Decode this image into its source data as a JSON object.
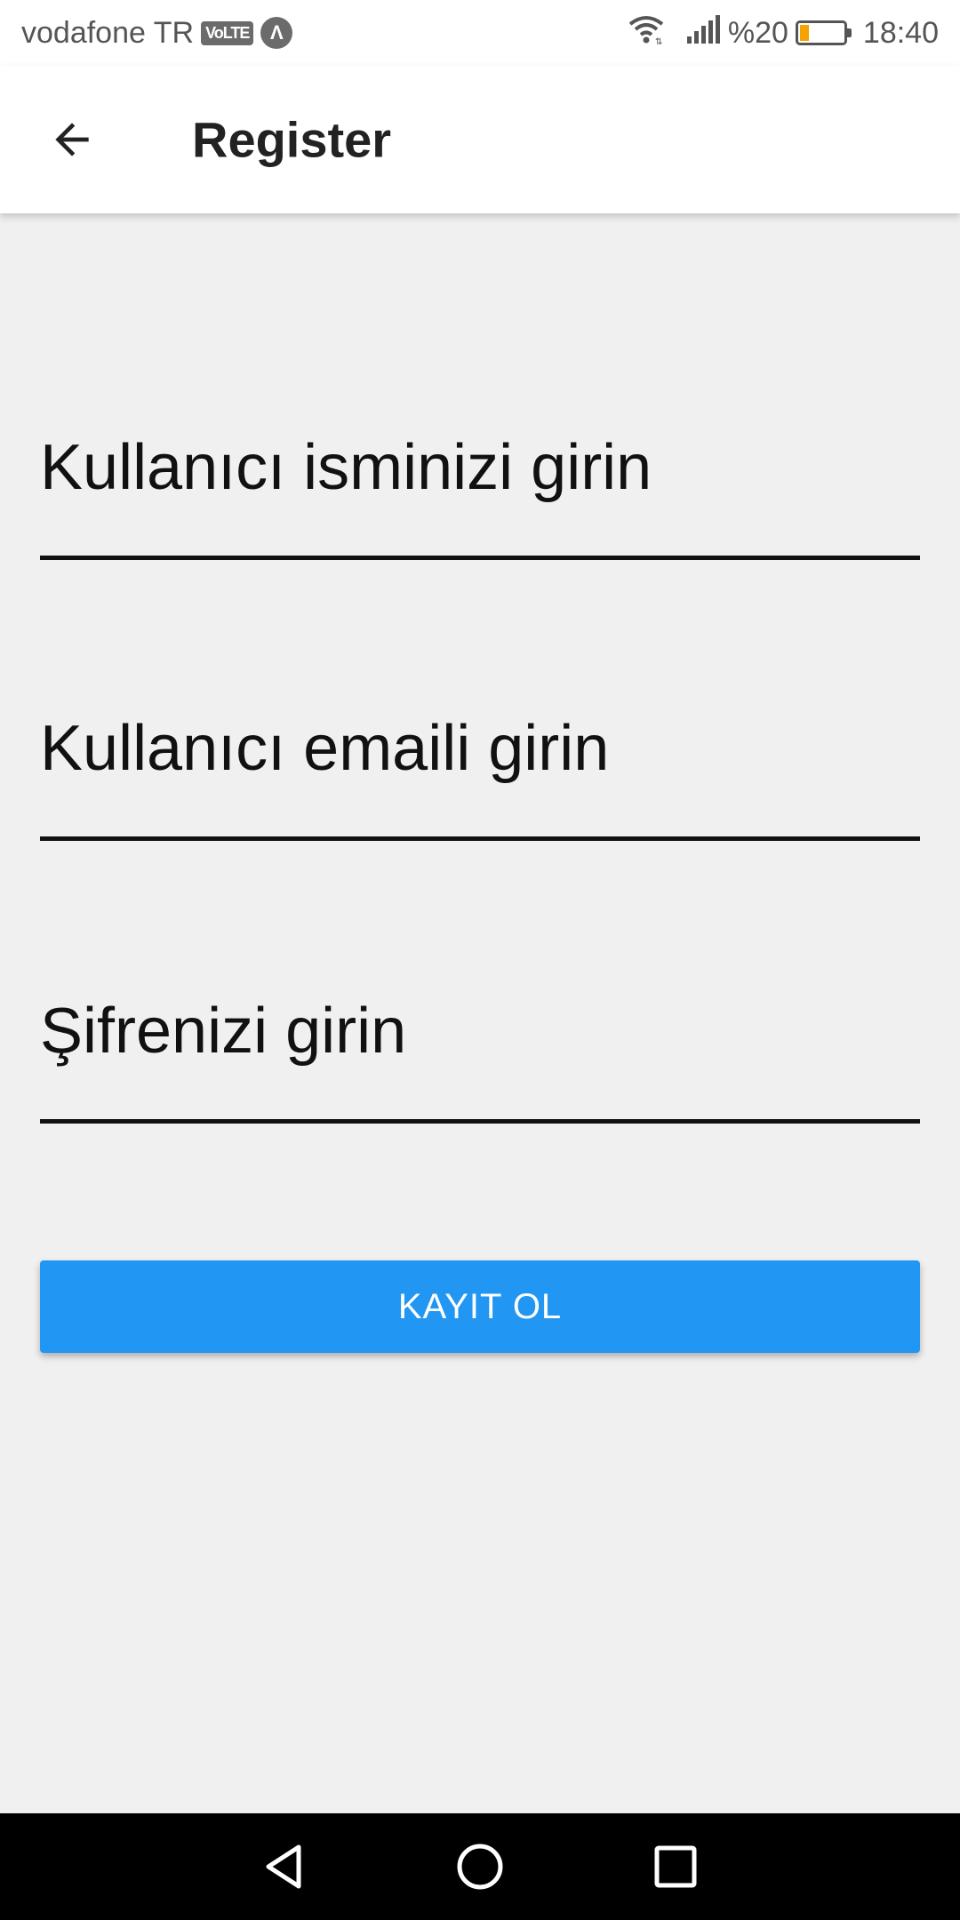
{
  "status_bar": {
    "carrier": "vodafone TR",
    "volte": "VoLTE",
    "app_badge": "Λ",
    "battery_percent": "%20",
    "battery_level": 0.2,
    "time": "18:40"
  },
  "app_bar": {
    "title": "Register"
  },
  "form": {
    "username_placeholder": "Kullanıcı isminizi girin",
    "email_placeholder": "Kullanıcı emaili girin",
    "password_placeholder": "Şifrenizi girin",
    "submit_label": "KAYIT OL"
  },
  "colors": {
    "primary": "#2196f3",
    "background": "#f0f0f0",
    "battery": "#f4a300"
  },
  "icons": {
    "back": "arrow-back-icon",
    "wifi": "wifi-icon",
    "signal": "signal-icon",
    "battery": "battery-icon",
    "nav_back": "triangle-back-icon",
    "nav_home": "circle-home-icon",
    "nav_recents": "square-recents-icon"
  }
}
